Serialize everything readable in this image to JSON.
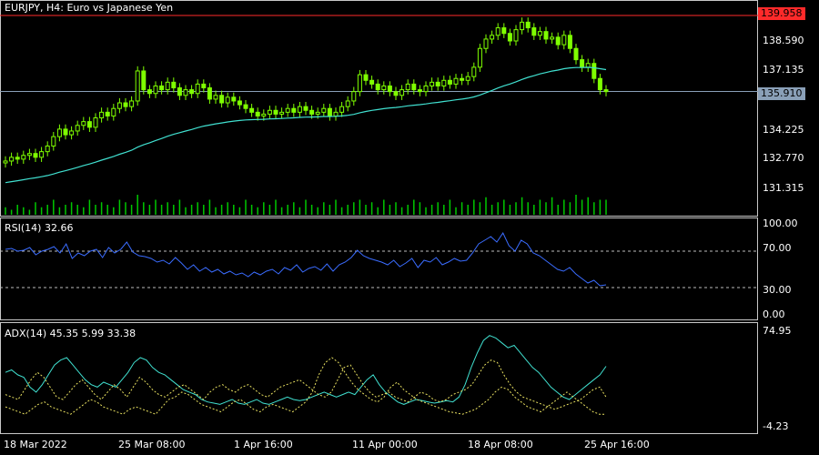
{
  "main_chart": {
    "title": "EURJPY, H4:  Euro vs Japanese Yen",
    "price_high_line": "139.958",
    "price_current": "135.910",
    "y_ticks": [
      "138.590",
      "137.135",
      "134.225",
      "132.770",
      "131.315"
    ],
    "colors": {
      "candle": "#7fff00",
      "ma": "#40e0d0",
      "hi_line": "#ff2a2a",
      "cur_line": "#8aa0b8",
      "volume": "#00c800"
    }
  },
  "rsi_panel": {
    "title": "RSI(14) 32.66",
    "y_ticks": [
      "100.00",
      "70.00",
      "30.00",
      "0.00"
    ],
    "color": "#3a6cff"
  },
  "adx_panel": {
    "title": "ADX(14) 45.35 5.99 33.38",
    "y_ticks": [
      "74.95",
      "-4.23"
    ],
    "colors": {
      "adx": "#40e0d0",
      "plus_di": "#e8e060",
      "minus_di": "#e8e060"
    }
  },
  "time_axis": {
    "labels": [
      "18 Mar 2022",
      "25 Mar 08:00",
      "1 Apr 16:00",
      "11 Apr 00:00",
      "18 Apr 08:00",
      "25 Apr 16:00"
    ]
  },
  "chart_data": [
    {
      "type": "candlestick",
      "title": "EURJPY, H4:  Euro vs Japanese Yen",
      "ylim": [
        130.5,
        140.2
      ],
      "close": [
        132.2,
        132.4,
        132.3,
        132.5,
        132.6,
        132.4,
        132.7,
        133.0,
        133.5,
        133.9,
        133.6,
        133.8,
        134.1,
        134.3,
        134.0,
        134.5,
        134.8,
        134.6,
        135.0,
        135.3,
        135.1,
        135.4,
        137.0,
        136.0,
        135.8,
        136.2,
        136.0,
        136.4,
        136.1,
        135.7,
        136.0,
        135.8,
        136.3,
        136.1,
        135.5,
        135.7,
        135.3,
        135.6,
        135.4,
        135.2,
        135.0,
        134.8,
        134.6,
        134.7,
        134.9,
        134.7,
        134.8,
        135.0,
        134.8,
        135.1,
        134.9,
        134.7,
        134.8,
        135.0,
        134.6,
        134.8,
        135.1,
        135.4,
        135.9,
        136.8,
        136.5,
        136.3,
        136.0,
        136.2,
        135.9,
        135.7,
        136.0,
        136.3,
        136.0,
        135.9,
        136.2,
        136.4,
        136.2,
        136.5,
        136.3,
        136.6,
        136.5,
        136.7,
        137.2,
        138.2,
        138.7,
        138.9,
        139.3,
        139.0,
        138.6,
        139.2,
        139.6,
        139.3,
        138.9,
        139.1,
        138.7,
        138.8,
        138.4,
        138.9,
        138.2,
        137.6,
        137.2,
        137.4,
        136.6,
        136.0,
        135.9
      ],
      "ma_start": 131.0,
      "volume": [
        3,
        2,
        4,
        3,
        2,
        5,
        3,
        4,
        6,
        3,
        4,
        5,
        4,
        3,
        6,
        4,
        5,
        4,
        3,
        6,
        5,
        4,
        8,
        5,
        4,
        6,
        4,
        5,
        4,
        6,
        3,
        4,
        5,
        4,
        6,
        3,
        4,
        5,
        4,
        3,
        6,
        4,
        3,
        5,
        4,
        6,
        3,
        4,
        5,
        3,
        6,
        4,
        3,
        5,
        4,
        6,
        3,
        4,
        5,
        6,
        4,
        5,
        3,
        6,
        4,
        5,
        3,
        4,
        6,
        5,
        3,
        4,
        5,
        4,
        6,
        3,
        5,
        4,
        6,
        5,
        7,
        4,
        5,
        6,
        4,
        5,
        7,
        5,
        4,
        6,
        5,
        7,
        4,
        6,
        5,
        8,
        6,
        7,
        5,
        6,
        6
      ]
    },
    {
      "type": "line",
      "title": "RSI(14) 32.66",
      "ylim": [
        0,
        100
      ],
      "values": [
        72,
        73,
        70,
        71,
        74,
        66,
        70,
        72,
        75,
        68,
        78,
        62,
        68,
        65,
        70,
        72,
        63,
        74,
        68,
        72,
        80,
        69,
        65,
        64,
        62,
        58,
        60,
        56,
        63,
        57,
        50,
        55,
        48,
        52,
        47,
        50,
        45,
        48,
        44,
        46,
        42,
        47,
        44,
        48,
        50,
        45,
        52,
        49,
        55,
        47,
        51,
        53,
        49,
        56,
        48,
        55,
        58,
        63,
        71,
        65,
        62,
        60,
        58,
        55,
        60,
        53,
        57,
        62,
        52,
        60,
        58,
        63,
        55,
        58,
        62,
        59,
        60,
        68,
        78,
        82,
        86,
        80,
        90,
        76,
        70,
        82,
        78,
        68,
        65,
        60,
        55,
        50,
        48,
        52,
        45,
        40,
        35,
        38,
        32,
        33
      ]
    },
    {
      "type": "line",
      "title": "ADX(14) 45.35 5.99 33.38",
      "ylim": [
        -4.23,
        74.95
      ],
      "series": [
        {
          "values": [
            40,
            42,
            38,
            36,
            28,
            24,
            30,
            38,
            46,
            50,
            52,
            46,
            40,
            34,
            30,
            28,
            32,
            30,
            28,
            34,
            40,
            48,
            52,
            50,
            44,
            40,
            38,
            34,
            30,
            26,
            24,
            22,
            18,
            16,
            15,
            14,
            16,
            18,
            15,
            14,
            16,
            18,
            15,
            14,
            16,
            18,
            20,
            18,
            17,
            18,
            20,
            22,
            24,
            22,
            20,
            22,
            24,
            22,
            28,
            34,
            38,
            30,
            24,
            20,
            16,
            14,
            16,
            18,
            17,
            16,
            15,
            16,
            17,
            16,
            20,
            30,
            44,
            56,
            66,
            70,
            68,
            64,
            60,
            62,
            56,
            50,
            44,
            40,
            34,
            28,
            24,
            20,
            18,
            22,
            26,
            30,
            34,
            38,
            45
          ]
        },
        {
          "values": [
            22,
            20,
            18,
            26,
            34,
            40,
            36,
            28,
            20,
            18,
            24,
            30,
            34,
            28,
            22,
            18,
            24,
            30,
            26,
            20,
            28,
            36,
            32,
            26,
            22,
            20,
            24,
            28,
            30,
            26,
            22,
            18,
            24,
            28,
            30,
            26,
            24,
            28,
            30,
            26,
            22,
            20,
            24,
            28,
            30,
            32,
            34,
            30,
            26,
            22,
            20,
            24,
            34,
            44,
            46,
            38,
            30,
            24,
            20,
            22,
            24,
            20,
            18,
            16,
            20,
            24,
            22,
            18,
            16,
            18,
            22,
            24,
            26,
            30,
            38,
            46,
            50,
            48,
            38,
            30,
            24,
            20,
            18,
            16,
            14,
            12,
            10,
            12,
            14,
            16,
            18,
            22,
            26,
            28,
            20
          ]
        },
        {
          "values": [
            12,
            10,
            8,
            6,
            10,
            14,
            16,
            12,
            10,
            8,
            6,
            10,
            14,
            18,
            16,
            12,
            10,
            8,
            6,
            10,
            12,
            10,
            8,
            6,
            12,
            18,
            20,
            24,
            22,
            18,
            14,
            12,
            10,
            8,
            12,
            16,
            18,
            14,
            10,
            8,
            12,
            14,
            12,
            10,
            8,
            12,
            16,
            24,
            38,
            48,
            52,
            48,
            40,
            32,
            26,
            22,
            18,
            16,
            20,
            28,
            32,
            26,
            22,
            18,
            16,
            14,
            12,
            10,
            8,
            7,
            6,
            8,
            10,
            14,
            18,
            24,
            28,
            26,
            20,
            16,
            12,
            10,
            8,
            12,
            16,
            20,
            24,
            20,
            16,
            12,
            8,
            6,
            6
          ]
        }
      ]
    }
  ]
}
